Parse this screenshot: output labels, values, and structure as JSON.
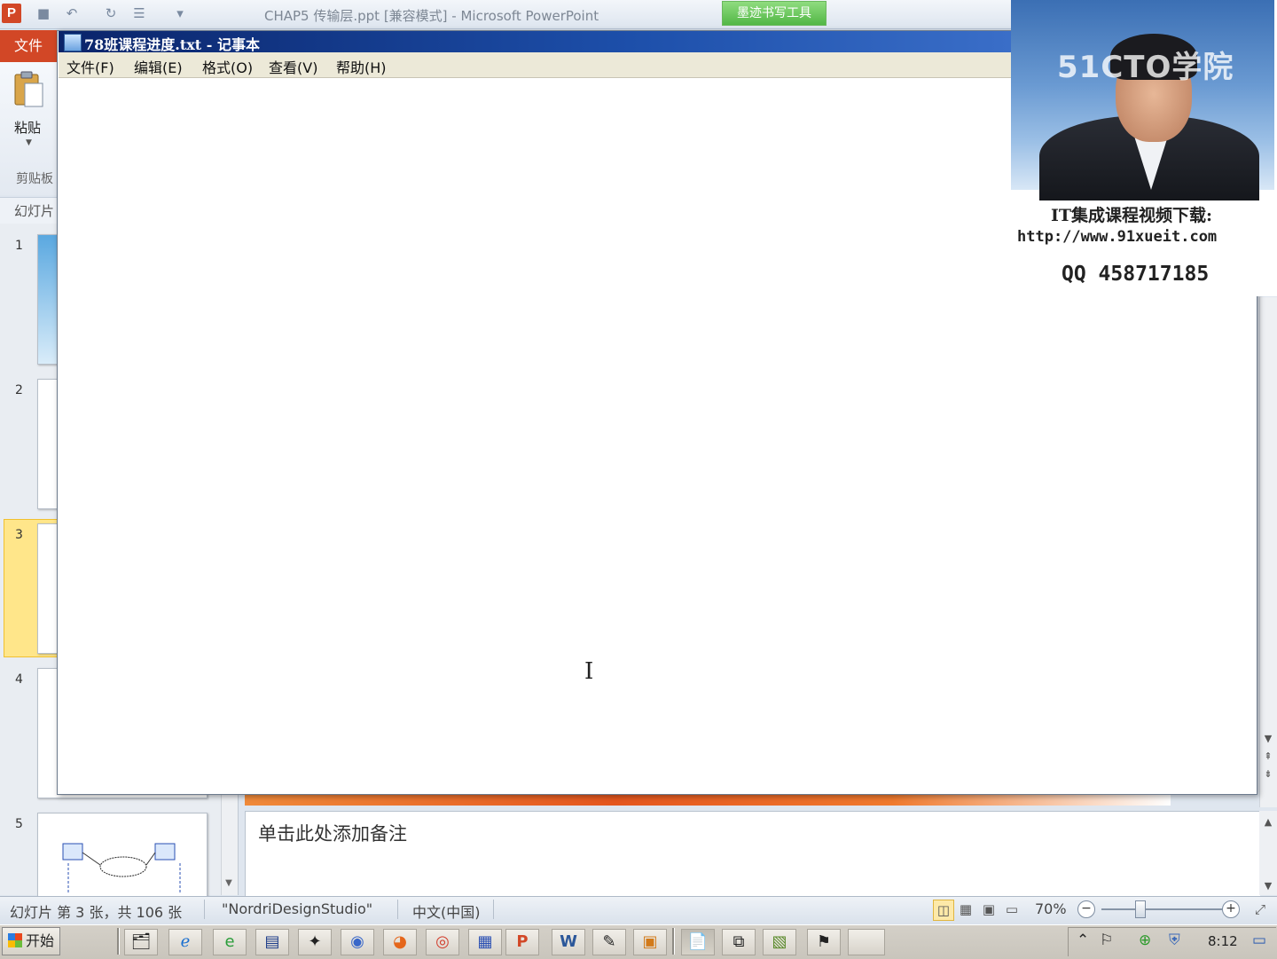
{
  "powerpoint": {
    "app_icon_letter": "P",
    "title": "CHAP5 传输层.ppt [兼容模式] - Microsoft PowerPoint",
    "contextual_tab": "墨迹书写工具",
    "file_tab": "文件",
    "paste_label": "粘贴",
    "clipboard_group": "剪贴板",
    "slides_tab": "幻灯片",
    "slide_numbers": [
      "1",
      "2",
      "3",
      "4",
      "5"
    ],
    "notes_placeholder": "单击此处添加备注",
    "status": {
      "slide_info": "幻灯片 第 3 张，共 106 张",
      "theme": "\"NordriDesignStudio\"",
      "language": "中文(中国)",
      "zoom": "70%",
      "zoom_minus": "−",
      "zoom_plus": "+"
    }
  },
  "notepad": {
    "title": "78班课程进度.txt - 记事本",
    "menu": [
      "文件(F)",
      "编辑(E)",
      "格式(O)",
      "查看(V)",
      "帮助(H)"
    ],
    "content": "",
    "caret": "I"
  },
  "overlay": {
    "logo": "51CTO学院",
    "line1": "IT集成课程视频下载:",
    "line2": "http://www.91xueit.com",
    "line3": "QQ 458717185"
  },
  "taskbar": {
    "start_label": "开始",
    "clock": "8:12"
  },
  "colors": {
    "ppt_accent": "#d24726",
    "notepad_title": "#0a246a",
    "ink_tools": "#52b746",
    "selected_slide": "#ffe68a"
  }
}
